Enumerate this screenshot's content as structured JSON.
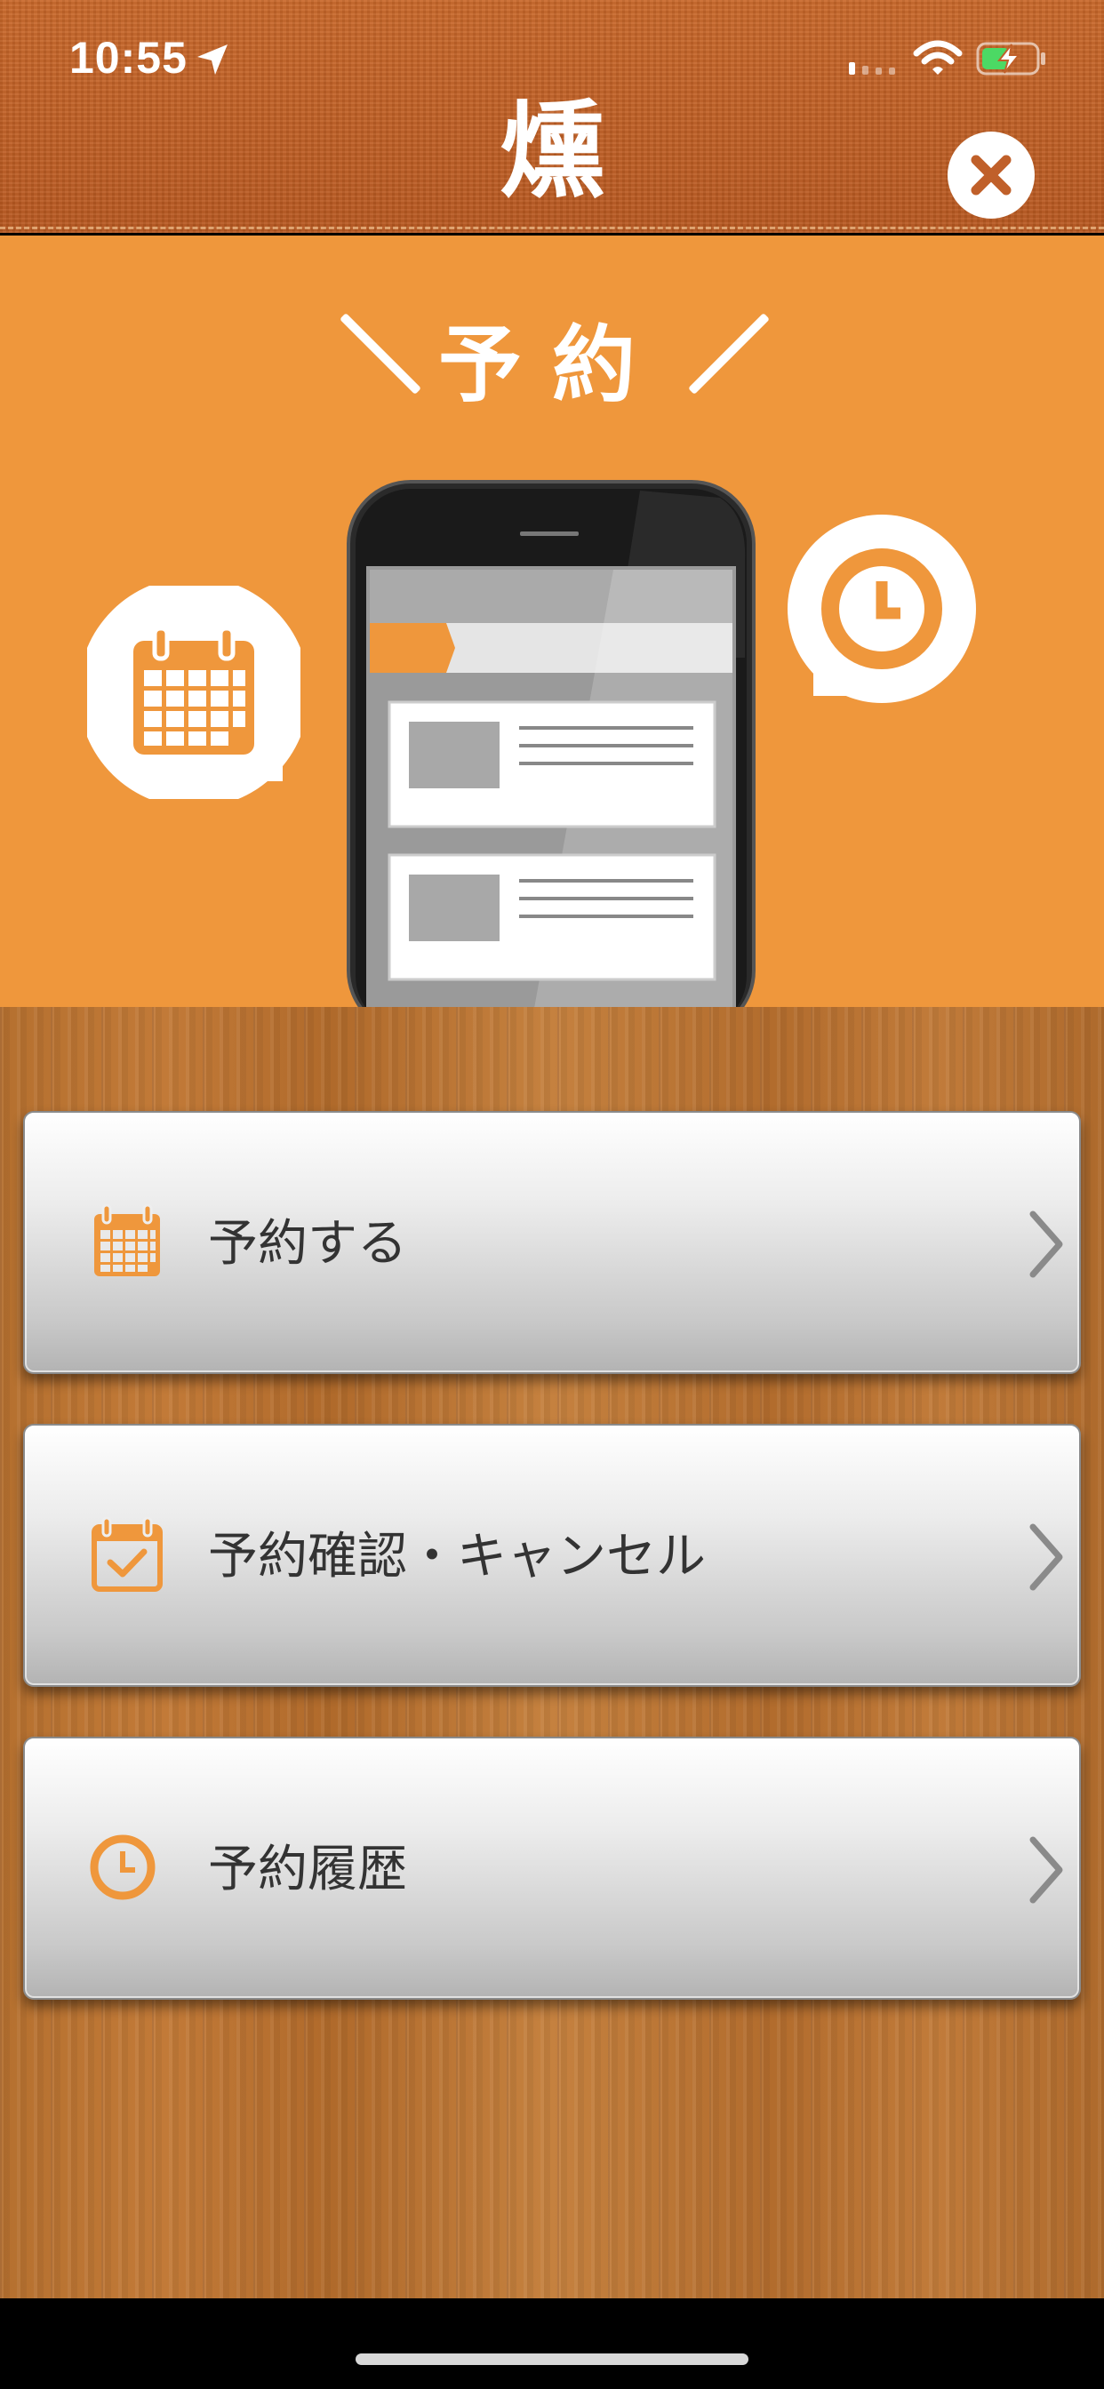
{
  "status_bar": {
    "time": "10:55",
    "icons": [
      "location-arrow-icon",
      "signal-icon",
      "wifi-icon",
      "battery-charging-icon"
    ]
  },
  "header": {
    "title": "燻",
    "close_icon": "close-icon"
  },
  "hero": {
    "title": "予約",
    "illustration": "phone-with-list",
    "left_bubble_icon": "calendar-icon",
    "right_bubble_icon": "clock-icon"
  },
  "menu": {
    "items": [
      {
        "label": "予約する",
        "icon": "calendar-icon"
      },
      {
        "label": "予約確認・キャンセル",
        "icon": "calendar-check-icon"
      },
      {
        "label": "予約履歴",
        "icon": "clock-icon"
      }
    ]
  },
  "colors": {
    "accent": "#ef973c",
    "header_leather": "#c0602a",
    "icon_orange": "#ef973c"
  }
}
